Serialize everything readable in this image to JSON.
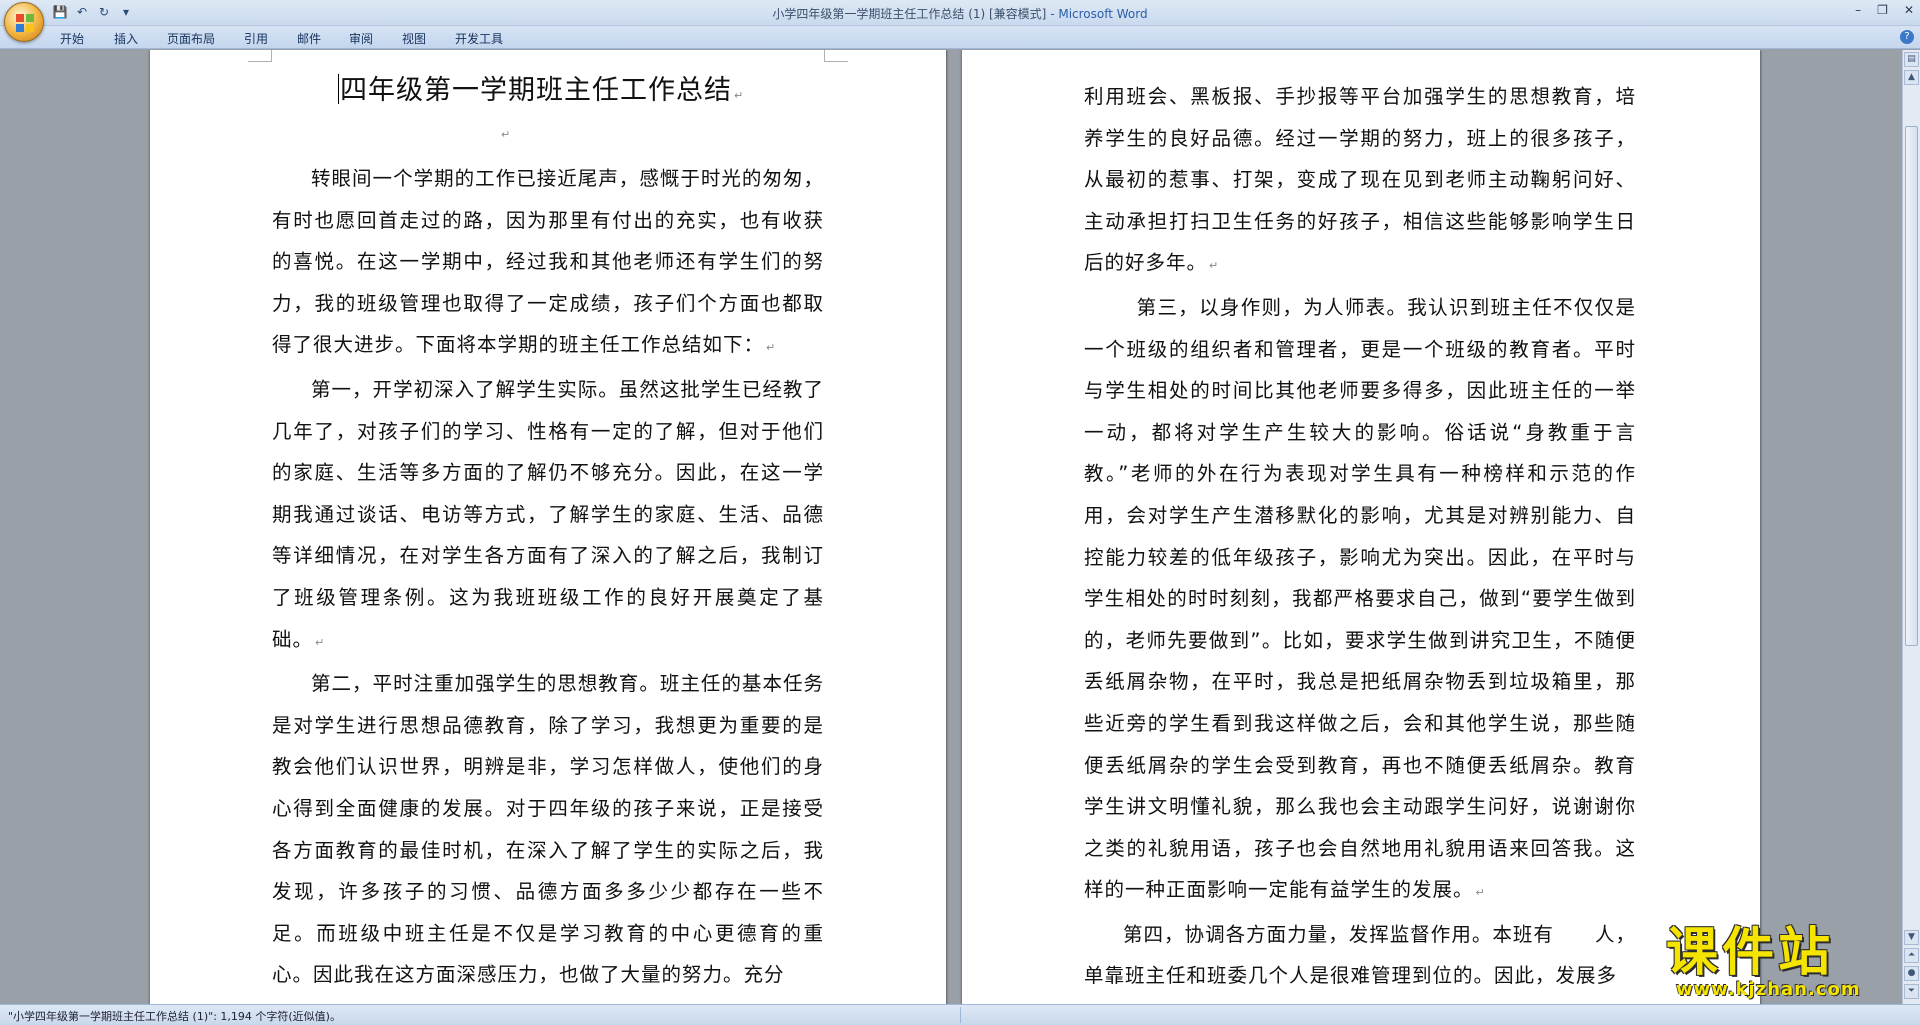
{
  "window": {
    "title": "小学四年级第一学期班主任工作总结 (1) [兼容模式]",
    "app_suffix": " - Microsoft Word",
    "min": "–",
    "max": "❐",
    "close": "✕"
  },
  "qat": {
    "save": "💾",
    "undo": "↶",
    "redo": "↻",
    "more": "▾"
  },
  "tabs": [
    "开始",
    "插入",
    "页面布局",
    "引用",
    "邮件",
    "审阅",
    "视图",
    "开发工具"
  ],
  "help": "?",
  "doc": {
    "title": "四年级第一学期班主任工作总结",
    "mark": "↵",
    "left_paragraphs": [
      "转眼间一个学期的工作已接近尾声，感慨于时光的匆匆，有时也愿回首走过的路，因为那里有付出的充实，也有收获的喜悦。在这一学期中，经过我和其他老师还有学生们的努力，我的班级管理也取得了一定成绩，孩子们个方面也都取得了很大进步。下面将本学期的班主任工作总结如下：",
      "第一，开学初深入了解学生实际。虽然这批学生已经教了几年了，对孩子们的学习、性格有一定的了解，但对于他们的家庭、生活等多方面的了解仍不够充分。因此，在这一学期我通过谈话、电访等方式，了解学生的家庭、生活、品德等详细情况，在对学生各方面有了深入的了解之后，我制订了班级管理条例。这为我班班级工作的良好开展奠定了基础。",
      "第二，平时注重加强学生的思想教育。班主任的基本任务是对学生进行思想品德教育，除了学习，我想更为重要的是教会他们认识世界，明辨是非，学习怎样做人，使他们的身心得到全面健康的发展。对于四年级的孩子来说，正是接受各方面教育的最佳时机，在深入了解了学生的实际之后，我发现，许多孩子的习惯、品德方面多多少少都存在一些不足。而班级中班主任是不仅是学习教育的中心更德育的重心。因此我在这方面深感压力，也做了大量的努力。充分"
    ],
    "right_paragraphs": [
      "利用班会、黑板报、手抄报等平台加强学生的思想教育，培养学生的良好品德。经过一学期的努力，班上的很多孩子，从最初的惹事、打架，变成了现在见到老师主动鞠躬问好、主动承担打扫卫生任务的好孩子，相信这些能够影响学生日后的好多年。",
      "第三，以身作则，为人师表。我认识到班主任不仅仅是一个班级的组织者和管理者，更是一个班级的教育者。平时与学生相处的时间比其他老师要多得多，因此班主任的一举一动，都将对学生产生较大的影响。俗话说“身教重于言教。”老师的外在行为表现对学生具有一种榜样和示范的作用，会对学生产生潜移默化的影响，尤其是对辨别能力、自控能力较差的低年级孩子，影响尤为突出。因此，在平时与学生相处的时时刻刻，我都严格要求自己，做到“要学生做到的，老师先要做到”。比如，要求学生做到讲究卫生，不随便丢纸屑杂物，在平时，我总是把纸屑杂物丢到垃圾箱里，那些近旁的学生看到我这样做之后，会和其他学生说，那些随便丢纸屑杂的学生会受到教育，再也不随便丢纸屑杂。教育学生讲文明懂礼貌，那么我也会主动跟学生问好，说谢谢你之类的礼貌用语，孩子也会自然地用礼貌用语来回答我。这样的一种正面影响一定能有益学生的发展。",
      "第四，协调各方面力量，发挥监督作用。本班有　　人，单靠班主任和班委几个人是很难管理到位的。因此，发展多"
    ]
  },
  "status": {
    "text": "\"小学四年级第一学期班主任工作总结 (1)\": 1,194 个字符(近似值)。"
  },
  "watermark": {
    "cn": "课件站",
    "url": "www.kjzhan.com"
  },
  "colors": {
    "title_blue": "#2a5ea8",
    "watermark_yellow": "#f5e400"
  }
}
